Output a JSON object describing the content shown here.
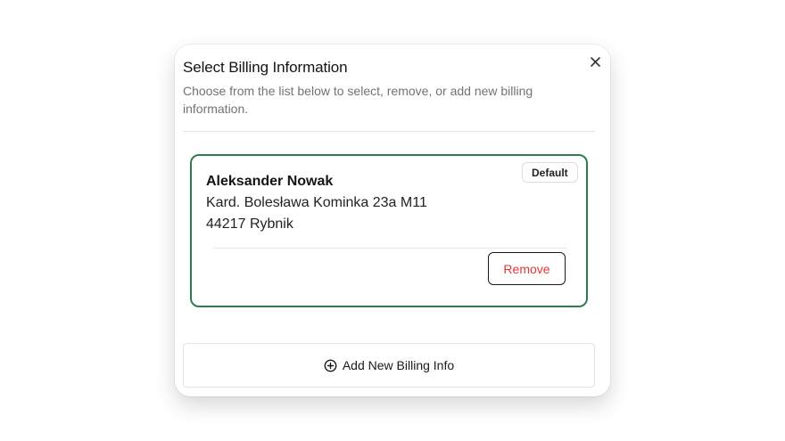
{
  "modal": {
    "title": "Select Billing Information",
    "subtitle": "Choose from the list below to select, remove, or add new billing information.",
    "close_icon": "close-icon"
  },
  "billing_card": {
    "name": "Aleksander Nowak",
    "address_line1": "Kard. Bolesława Kominka 23a M11",
    "address_line2": "44217 Rybnik",
    "badge": "Default",
    "remove_label": "Remove",
    "selected": true
  },
  "add_button": {
    "label": "Add New Billing Info",
    "icon": "plus-circle-icon"
  },
  "colors": {
    "selected_border": "#2e7d4f",
    "remove_text": "#e53935",
    "subtitle_text": "#737373"
  }
}
